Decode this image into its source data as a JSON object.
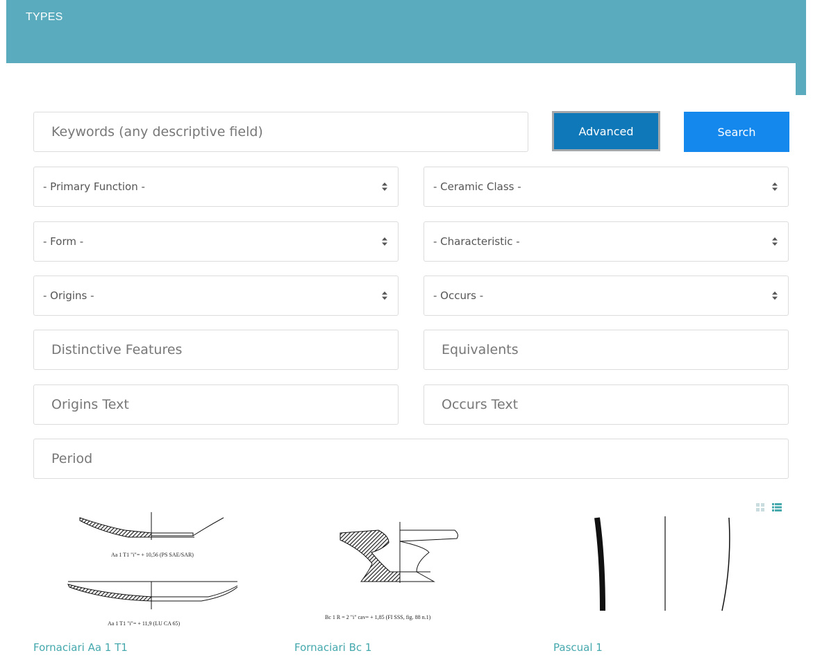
{
  "header": {
    "title": "TYPES"
  },
  "search": {
    "keywords_placeholder": "Keywords (any descriptive field)",
    "advanced_label": "Advanced",
    "search_label": "Search"
  },
  "filters": {
    "primary_function": "- Primary Function -",
    "ceramic_class": "- Ceramic Class -",
    "form": "- Form -",
    "characteristic": "- Characteristic -",
    "origins": "- Origins -",
    "occurs": "- Occurs -",
    "distinctive_features": "Distinctive Features",
    "equivalents": "Equivalents",
    "origins_text": "Origins Text",
    "occurs_text": "Occurs Text",
    "period": "Period"
  },
  "view_toggle": {
    "icons": [
      "grid-view-icon",
      "list-view-icon"
    ],
    "active": "list-view-icon",
    "active_color": "#44a8ad",
    "inactive_color": "#c9dde0"
  },
  "results": [
    {
      "title": "Fornaciari Aa 1 T1",
      "captions": [
        "Aa 1  T1 \"i\"= + 10,56 (PS SAE/SAR)",
        "Aa 1  T1 \"i\"= + 11,9 (LU CA 65)"
      ]
    },
    {
      "title": "Fornaciari Bc 1",
      "captions": [
        "Bc 1  R = 2 \"i\" cav= + 1,85 (FI SSS, fig. 88 n.1)"
      ]
    },
    {
      "title": "Pascual 1",
      "captions": []
    }
  ],
  "colors": {
    "header": "#59abbd",
    "advanced": "#0e78b8",
    "search": "#1588ee",
    "link": "#44a8ad"
  }
}
